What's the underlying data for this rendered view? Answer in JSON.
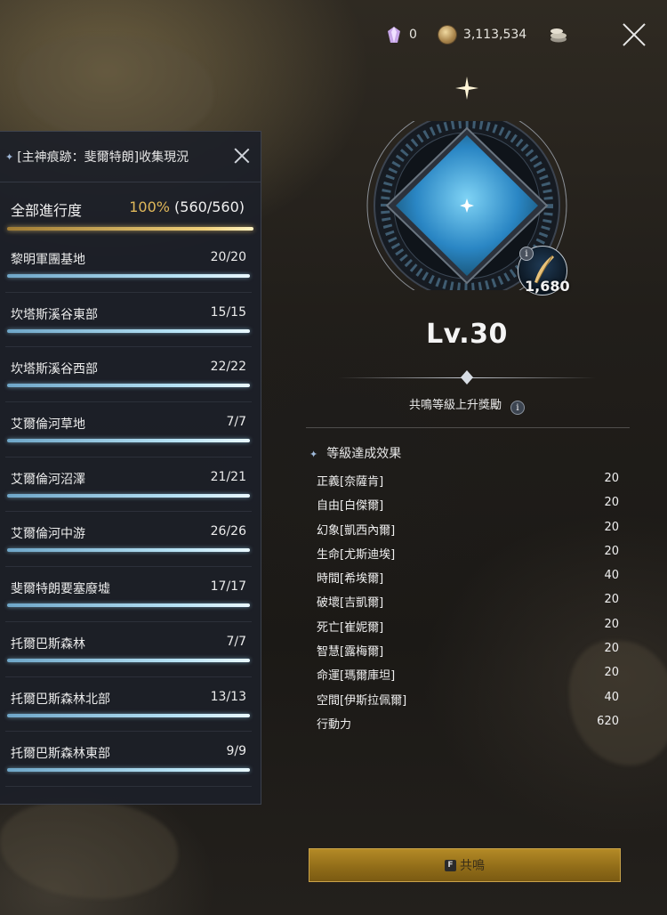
{
  "topbar": {
    "crystal_count": "0",
    "gold_amount": "3,113,534"
  },
  "panel": {
    "title": "[主神痕跡：斐爾特朗]收集現況",
    "total_label": "全部進行度",
    "total_percent": "100%",
    "total_count": "(560/560)",
    "total_progress": 1.0,
    "rows": [
      {
        "name": "黎明軍團基地",
        "count": "20/20",
        "progress": 1.0
      },
      {
        "name": "坎塔斯溪谷東部",
        "count": "15/15",
        "progress": 1.0
      },
      {
        "name": "坎塔斯溪谷西部",
        "count": "22/22",
        "progress": 1.0
      },
      {
        "name": "艾爾倫河草地",
        "count": "7/7",
        "progress": 1.0
      },
      {
        "name": "艾爾倫河沼澤",
        "count": "21/21",
        "progress": 1.0
      },
      {
        "name": "艾爾倫河中游",
        "count": "26/26",
        "progress": 1.0
      },
      {
        "name": "斐爾特朗要塞廢墟",
        "count": "17/17",
        "progress": 1.0
      },
      {
        "name": "托爾巴斯森林",
        "count": "7/7",
        "progress": 1.0
      },
      {
        "name": "托爾巴斯森林北部",
        "count": "13/13",
        "progress": 1.0
      },
      {
        "name": "托爾巴斯森林東部",
        "count": "9/9",
        "progress": 1.0
      }
    ]
  },
  "emblem": {
    "cost": "1,680",
    "info_glyph": "i"
  },
  "level": "Lv.30",
  "reward_label": "共鳴等級上升獎勵",
  "info_glyph": "i",
  "effects_title": "等級達成效果",
  "effects": [
    {
      "name": "正義[奈薩肯]",
      "value": "20"
    },
    {
      "name": "自由[白傑爾]",
      "value": "20"
    },
    {
      "name": "幻象[凱西內爾]",
      "value": "20"
    },
    {
      "name": "生命[尤斯迪埃]",
      "value": "20"
    },
    {
      "name": "時間[希埃爾]",
      "value": "40"
    },
    {
      "name": "破壞[吉凱爾]",
      "value": "20"
    },
    {
      "name": "死亡[崔妮爾]",
      "value": "20"
    },
    {
      "name": "智慧[露梅爾]",
      "value": "20"
    },
    {
      "name": "命運[瑪爾庫坦]",
      "value": "20"
    },
    {
      "name": "空間[伊斯拉佩爾]",
      "value": "40"
    },
    {
      "name": "行動力",
      "value": "620"
    }
  ],
  "resonate_button": {
    "key": "F",
    "label": "共鳴"
  },
  "colors": {
    "accent_gold": "#e0b85a",
    "progress_blue": "#b7e3f5",
    "button_gold": "#b48a26"
  }
}
